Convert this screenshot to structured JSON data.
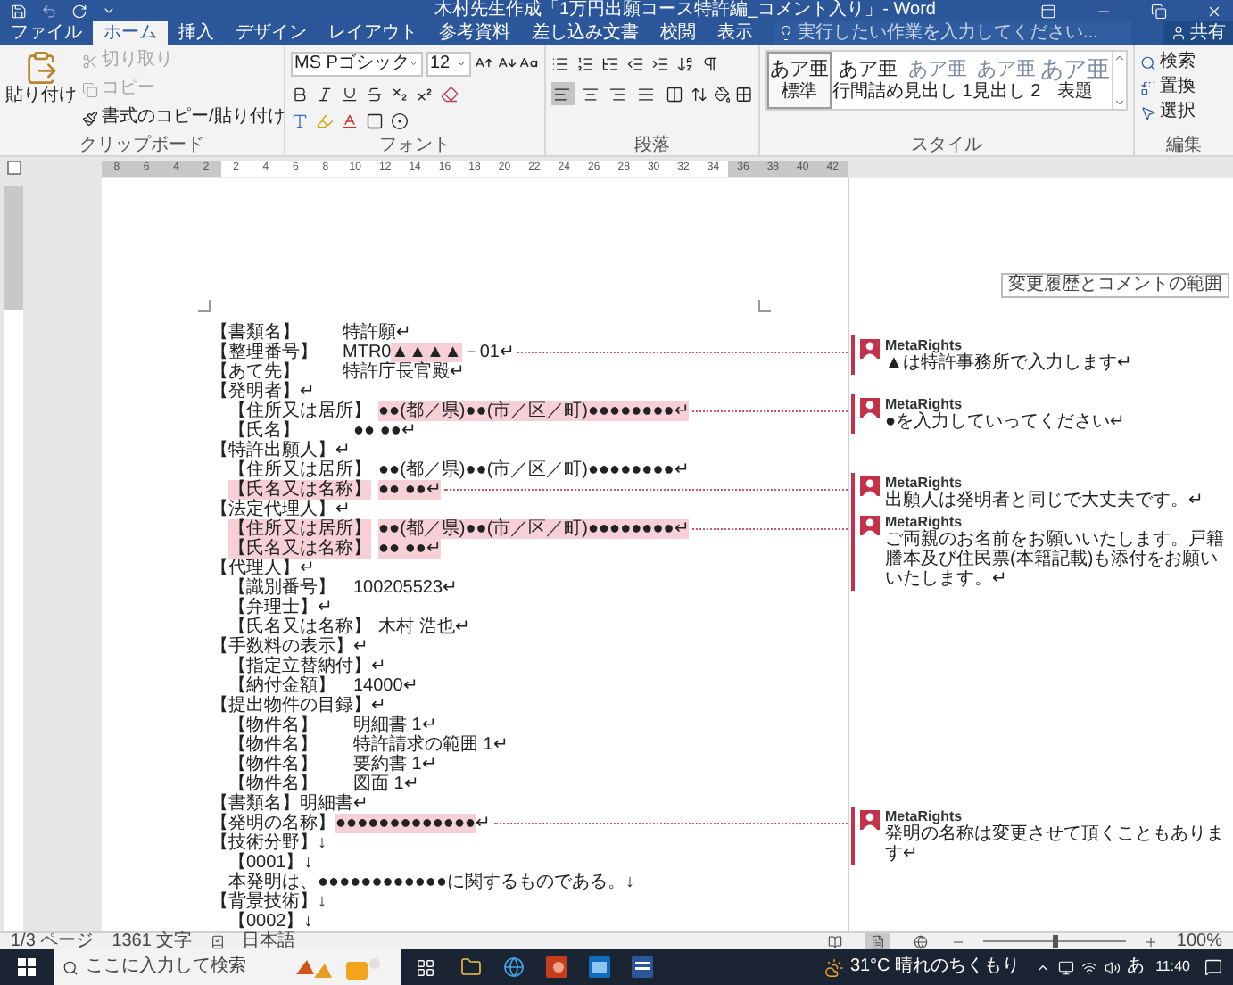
{
  "window": {
    "title": "木村先生作成「1万円出願コース特許編_コメント入り」- Word"
  },
  "tabs": [
    {
      "label": "ファイル",
      "selected": false
    },
    {
      "label": "ホーム",
      "selected": true
    },
    {
      "label": "挿入",
      "selected": false
    },
    {
      "label": "デザイン",
      "selected": false
    },
    {
      "label": "レイアウト",
      "selected": false
    },
    {
      "label": "参考資料",
      "selected": false
    },
    {
      "label": "差し込み文書",
      "selected": false
    },
    {
      "label": "校閲",
      "selected": false
    },
    {
      "label": "表示",
      "selected": false
    }
  ],
  "tell_me": {
    "placeholder": "実行したい作業を入力してください..."
  },
  "share": "共有",
  "clipboard": {
    "group": "クリップボード",
    "paste": "貼り付け",
    "items": [
      {
        "label": "切り取り",
        "disabled": true
      },
      {
        "label": "コピー",
        "disabled": true
      },
      {
        "label": "書式のコピー/貼り付け",
        "disabled": false
      }
    ]
  },
  "font": {
    "group": "フォント",
    "name": "MS Pゴシック",
    "size": "12"
  },
  "paragraph": {
    "group": "段落",
    "align": [
      {
        "selected": true
      },
      {
        "selected": false
      },
      {
        "selected": false
      },
      {
        "selected": false
      },
      {
        "selected": false
      }
    ]
  },
  "styles": {
    "group": "スタイル",
    "items": [
      {
        "sample": "あア亜",
        "label": "標準",
        "kind": "body",
        "selected": true
      },
      {
        "sample": "あア亜",
        "label": "行間詰め",
        "kind": "body",
        "selected": false
      },
      {
        "sample": "あア亜",
        "label": "見出し 1",
        "kind": "heading",
        "selected": false
      },
      {
        "sample": "あア亜",
        "label": "見出し 2",
        "kind": "heading",
        "selected": false
      },
      {
        "sample": "あア亜",
        "label": "表題",
        "kind": "title",
        "selected": false
      }
    ]
  },
  "editing": {
    "group": "編集",
    "items": [
      "検索",
      "置換",
      "選択"
    ]
  },
  "ruler": [
    {
      "label": "8",
      "margin": true
    },
    {
      "label": "6",
      "margin": true
    },
    {
      "label": "4",
      "margin": true
    },
    {
      "label": "2",
      "margin": true
    },
    {
      "label": "2",
      "margin": false
    },
    {
      "label": "4",
      "margin": false
    },
    {
      "label": "6",
      "margin": false
    },
    {
      "label": "8",
      "margin": false
    },
    {
      "label": "10",
      "margin": false
    },
    {
      "label": "12",
      "margin": false
    },
    {
      "label": "14",
      "margin": false
    },
    {
      "label": "16",
      "margin": false
    },
    {
      "label": "18",
      "margin": false
    },
    {
      "label": "20",
      "margin": false
    },
    {
      "label": "22",
      "margin": false
    },
    {
      "label": "24",
      "margin": false
    },
    {
      "label": "26",
      "margin": false
    },
    {
      "label": "28",
      "margin": false
    },
    {
      "label": "30",
      "margin": false
    },
    {
      "label": "32",
      "margin": false
    },
    {
      "label": "34",
      "margin": false
    },
    {
      "label": "36",
      "margin": true
    },
    {
      "label": "38",
      "margin": true
    },
    {
      "label": "40",
      "margin": true
    },
    {
      "label": "42",
      "margin": true
    }
  ],
  "tooltip": "変更履歴とコメントの範囲",
  "document": [
    {
      "kind": "field",
      "label": "【書類名】",
      "commented": false,
      "parts": [
        {
          "text": "特許願↵",
          "commented": false
        }
      ]
    },
    {
      "kind": "field",
      "label": "【整理番号】",
      "commented": false,
      "parts": [
        {
          "text": "MTR0",
          "commented": false
        },
        {
          "text": "▲▲▲▲",
          "commented": true
        },
        {
          "text": "－01↵",
          "commented": false
        }
      ],
      "comment": {
        "author": "MetaRights",
        "text": "▲は特許事務所で入力します↵"
      }
    },
    {
      "kind": "field",
      "label": "【あて先】",
      "commented": false,
      "parts": [
        {
          "text": "特許庁長官殿↵",
          "commented": false
        }
      ]
    },
    {
      "kind": "field",
      "label": "【発明者】↵",
      "commented": false,
      "children": [
        {
          "kind": "field",
          "label": "【住所又は居所】",
          "commented": false,
          "parts": [
            {
              "text": "●●(都／県)●●(市／区／町)●●●●●●●●↵",
              "commented": true
            }
          ],
          "comment": {
            "author": "MetaRights",
            "text": "●を入力していってください↵"
          }
        },
        {
          "kind": "field",
          "label": "【氏名】",
          "commented": false,
          "parts": [
            {
              "text": "●● ●●↵",
              "commented": false
            }
          ]
        }
      ]
    },
    {
      "kind": "field",
      "label": "【特許出願人】↵",
      "commented": false,
      "children": [
        {
          "kind": "field",
          "label": "【住所又は居所】",
          "commented": false,
          "parts": [
            {
              "text": "●●(都／県)●●(市／区／町)●●●●●●●●↵",
              "commented": false
            }
          ]
        },
        {
          "kind": "field",
          "label": "【氏名又は名称】",
          "commented": true,
          "parts": [
            {
              "text": "●● ●●↵",
              "commented": true
            }
          ],
          "comment": {
            "author": "MetaRights",
            "text": "出願人は発明者と同じで大丈夫です。↵"
          }
        }
      ]
    },
    {
      "kind": "field",
      "label": "【法定代理人】↵",
      "commented": false,
      "children": [
        {
          "kind": "field",
          "label": "【住所又は居所】",
          "commented": true,
          "parts": [
            {
              "text": "●●(都／県)●●(市／区／町)●●●●●●●●↵",
              "commented": true
            }
          ],
          "comment": {
            "author": "MetaRights",
            "text": "ご両親のお名前をお願いいたします。戸籍謄本及び住民票(本籍記載)も添付をお願いいたします。↵"
          }
        },
        {
          "kind": "field",
          "label": "【氏名又は名称】",
          "commented": true,
          "parts": [
            {
              "text": "●● ●●↵",
              "commented": true
            }
          ]
        }
      ]
    },
    {
      "kind": "field",
      "label": "【代理人】↵",
      "commented": false,
      "children": [
        {
          "kind": "field",
          "label": "【識別番号】",
          "commented": false,
          "parts": [
            {
              "text": "100205523↵",
              "commented": false
            }
          ]
        },
        {
          "kind": "field",
          "label": "【弁理士】↵",
          "commented": false
        },
        {
          "kind": "field",
          "label": "【氏名又は名称】",
          "commented": false,
          "parts": [
            {
              "text": "木村 浩也↵",
              "commented": false
            }
          ]
        }
      ]
    },
    {
      "kind": "field",
      "label": "【手数料の表示】↵",
      "commented": false,
      "children": [
        {
          "kind": "field",
          "label": "【指定立替納付】↵",
          "commented": false
        },
        {
          "kind": "field",
          "label": "【納付金額】",
          "commented": false,
          "parts": [
            {
              "text": "14000↵",
              "commented": false
            }
          ]
        }
      ]
    },
    {
      "kind": "field",
      "label": "【提出物件の目録】↵",
      "commented": false,
      "children": [
        {
          "kind": "field",
          "label": "【物件名】",
          "commented": false,
          "parts": [
            {
              "text": "明細書 1↵",
              "commented": false
            }
          ]
        },
        {
          "kind": "field",
          "label": "【物件名】",
          "commented": false,
          "parts": [
            {
              "text": "特許請求の範囲 1↵",
              "commented": false
            }
          ]
        },
        {
          "kind": "field",
          "label": "【物件名】",
          "commented": false,
          "parts": [
            {
              "text": "要約書 1↵",
              "commented": false
            }
          ]
        },
        {
          "kind": "field",
          "label": "【物件名】",
          "commented": false,
          "parts": [
            {
              "text": "図面 1↵",
              "commented": false
            }
          ]
        }
      ]
    },
    {
      "kind": "inline",
      "label": "【書類名】明細書↵",
      "commented": false
    },
    {
      "kind": "inline",
      "label": "【発明の名称】",
      "commented": false,
      "parts": [
        {
          "text": "●●●●●●●●●●●●●",
          "commented": true
        },
        {
          "text": "↵",
          "commented": false
        }
      ],
      "comment": {
        "author": "MetaRights",
        "text": "発明の名称は変更させて頂くこともあります↵"
      }
    },
    {
      "kind": "inline",
      "label": "【技術分野】↓",
      "commented": false,
      "children": [
        {
          "kind": "inline",
          "label": "【0001】↓",
          "commented": false
        },
        {
          "kind": "inline",
          "label": "本発明は、●●●●●●●●●●●●に関するものである。↓",
          "commented": false
        }
      ]
    },
    {
      "kind": "inline",
      "label": "【背景技術】↓",
      "commented": false,
      "children": [
        {
          "kind": "inline",
          "label": "【0002】↓",
          "commented": false
        }
      ]
    }
  ],
  "status_bar": {
    "page": "1/3 ページ",
    "words": "1361 文字",
    "language": "日本語",
    "views": [
      {
        "selected": false
      },
      {
        "selected": true
      },
      {
        "selected": false
      }
    ],
    "zoom": {
      "level": 0.5,
      "reading": "100%"
    }
  },
  "taskbar": {
    "search": {
      "placeholder": "ここに入力して検索"
    },
    "weather": "31°C 晴れのちくもり",
    "ime": "あ",
    "time": "11:40"
  }
}
